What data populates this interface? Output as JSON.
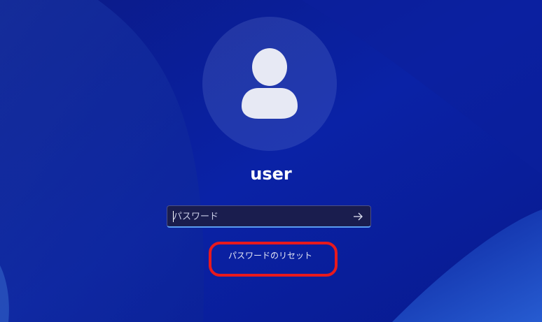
{
  "user": {
    "name": "user",
    "avatar_icon": "person-icon"
  },
  "password": {
    "value": "",
    "placeholder": "パスワード",
    "submit_icon": "arrow-right-icon"
  },
  "links": {
    "reset_password": "パスワードのリセット"
  },
  "annotation": {
    "color": "#e8191d",
    "target": "reset-password-link"
  },
  "colors": {
    "background": "#0a1d9a",
    "input_accent": "#5b9cf0"
  }
}
